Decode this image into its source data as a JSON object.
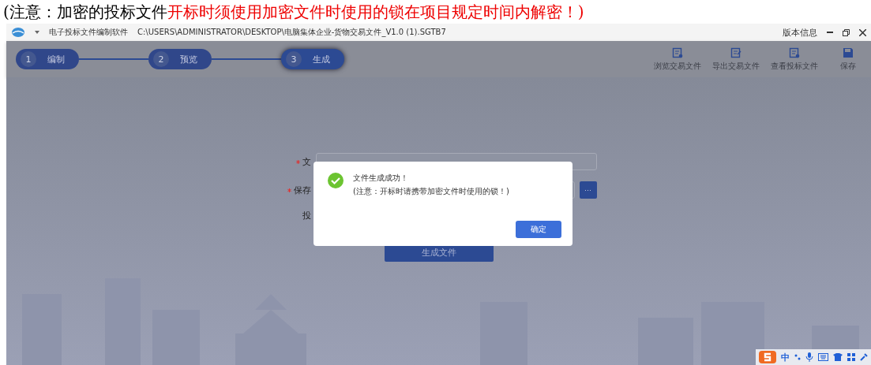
{
  "caption": {
    "prefix": "(注意：加密的投标文件",
    "highlight": "开标时须使用加密文件时使用的锁在项目规定时间内解密！)"
  },
  "window": {
    "app_name": "电子投标文件编制软件",
    "path": "C:\\USERS\\ADMINISTRATOR\\DESKTOP\\电脑集体企业-货物交易文件_V1.0 (1).SGTB7",
    "version_link": "版本信息"
  },
  "steps": [
    {
      "number": "1",
      "label": "编制",
      "selected": false
    },
    {
      "number": "2",
      "label": "预览",
      "selected": false
    },
    {
      "number": "3",
      "label": "生成",
      "selected": true
    }
  ],
  "toolbar": [
    {
      "kind": "browse",
      "label": "浏览交易文件"
    },
    {
      "kind": "export",
      "label": "导出交易文件"
    },
    {
      "kind": "view",
      "label": "查看投标文件"
    },
    {
      "kind": "save",
      "label": "保存"
    }
  ],
  "form": {
    "fields": [
      {
        "label": "文",
        "required": true
      },
      {
        "label": "保存",
        "required": true,
        "browse_button": "···"
      },
      {
        "label": "投",
        "required": false
      }
    ],
    "generate_button": "生成文件"
  },
  "dialog": {
    "title": "文件生成成功！",
    "note": "(注意：开标时请携带加密文件时使用的锁！)",
    "ok_button": "确定"
  },
  "tray_text": "中"
}
